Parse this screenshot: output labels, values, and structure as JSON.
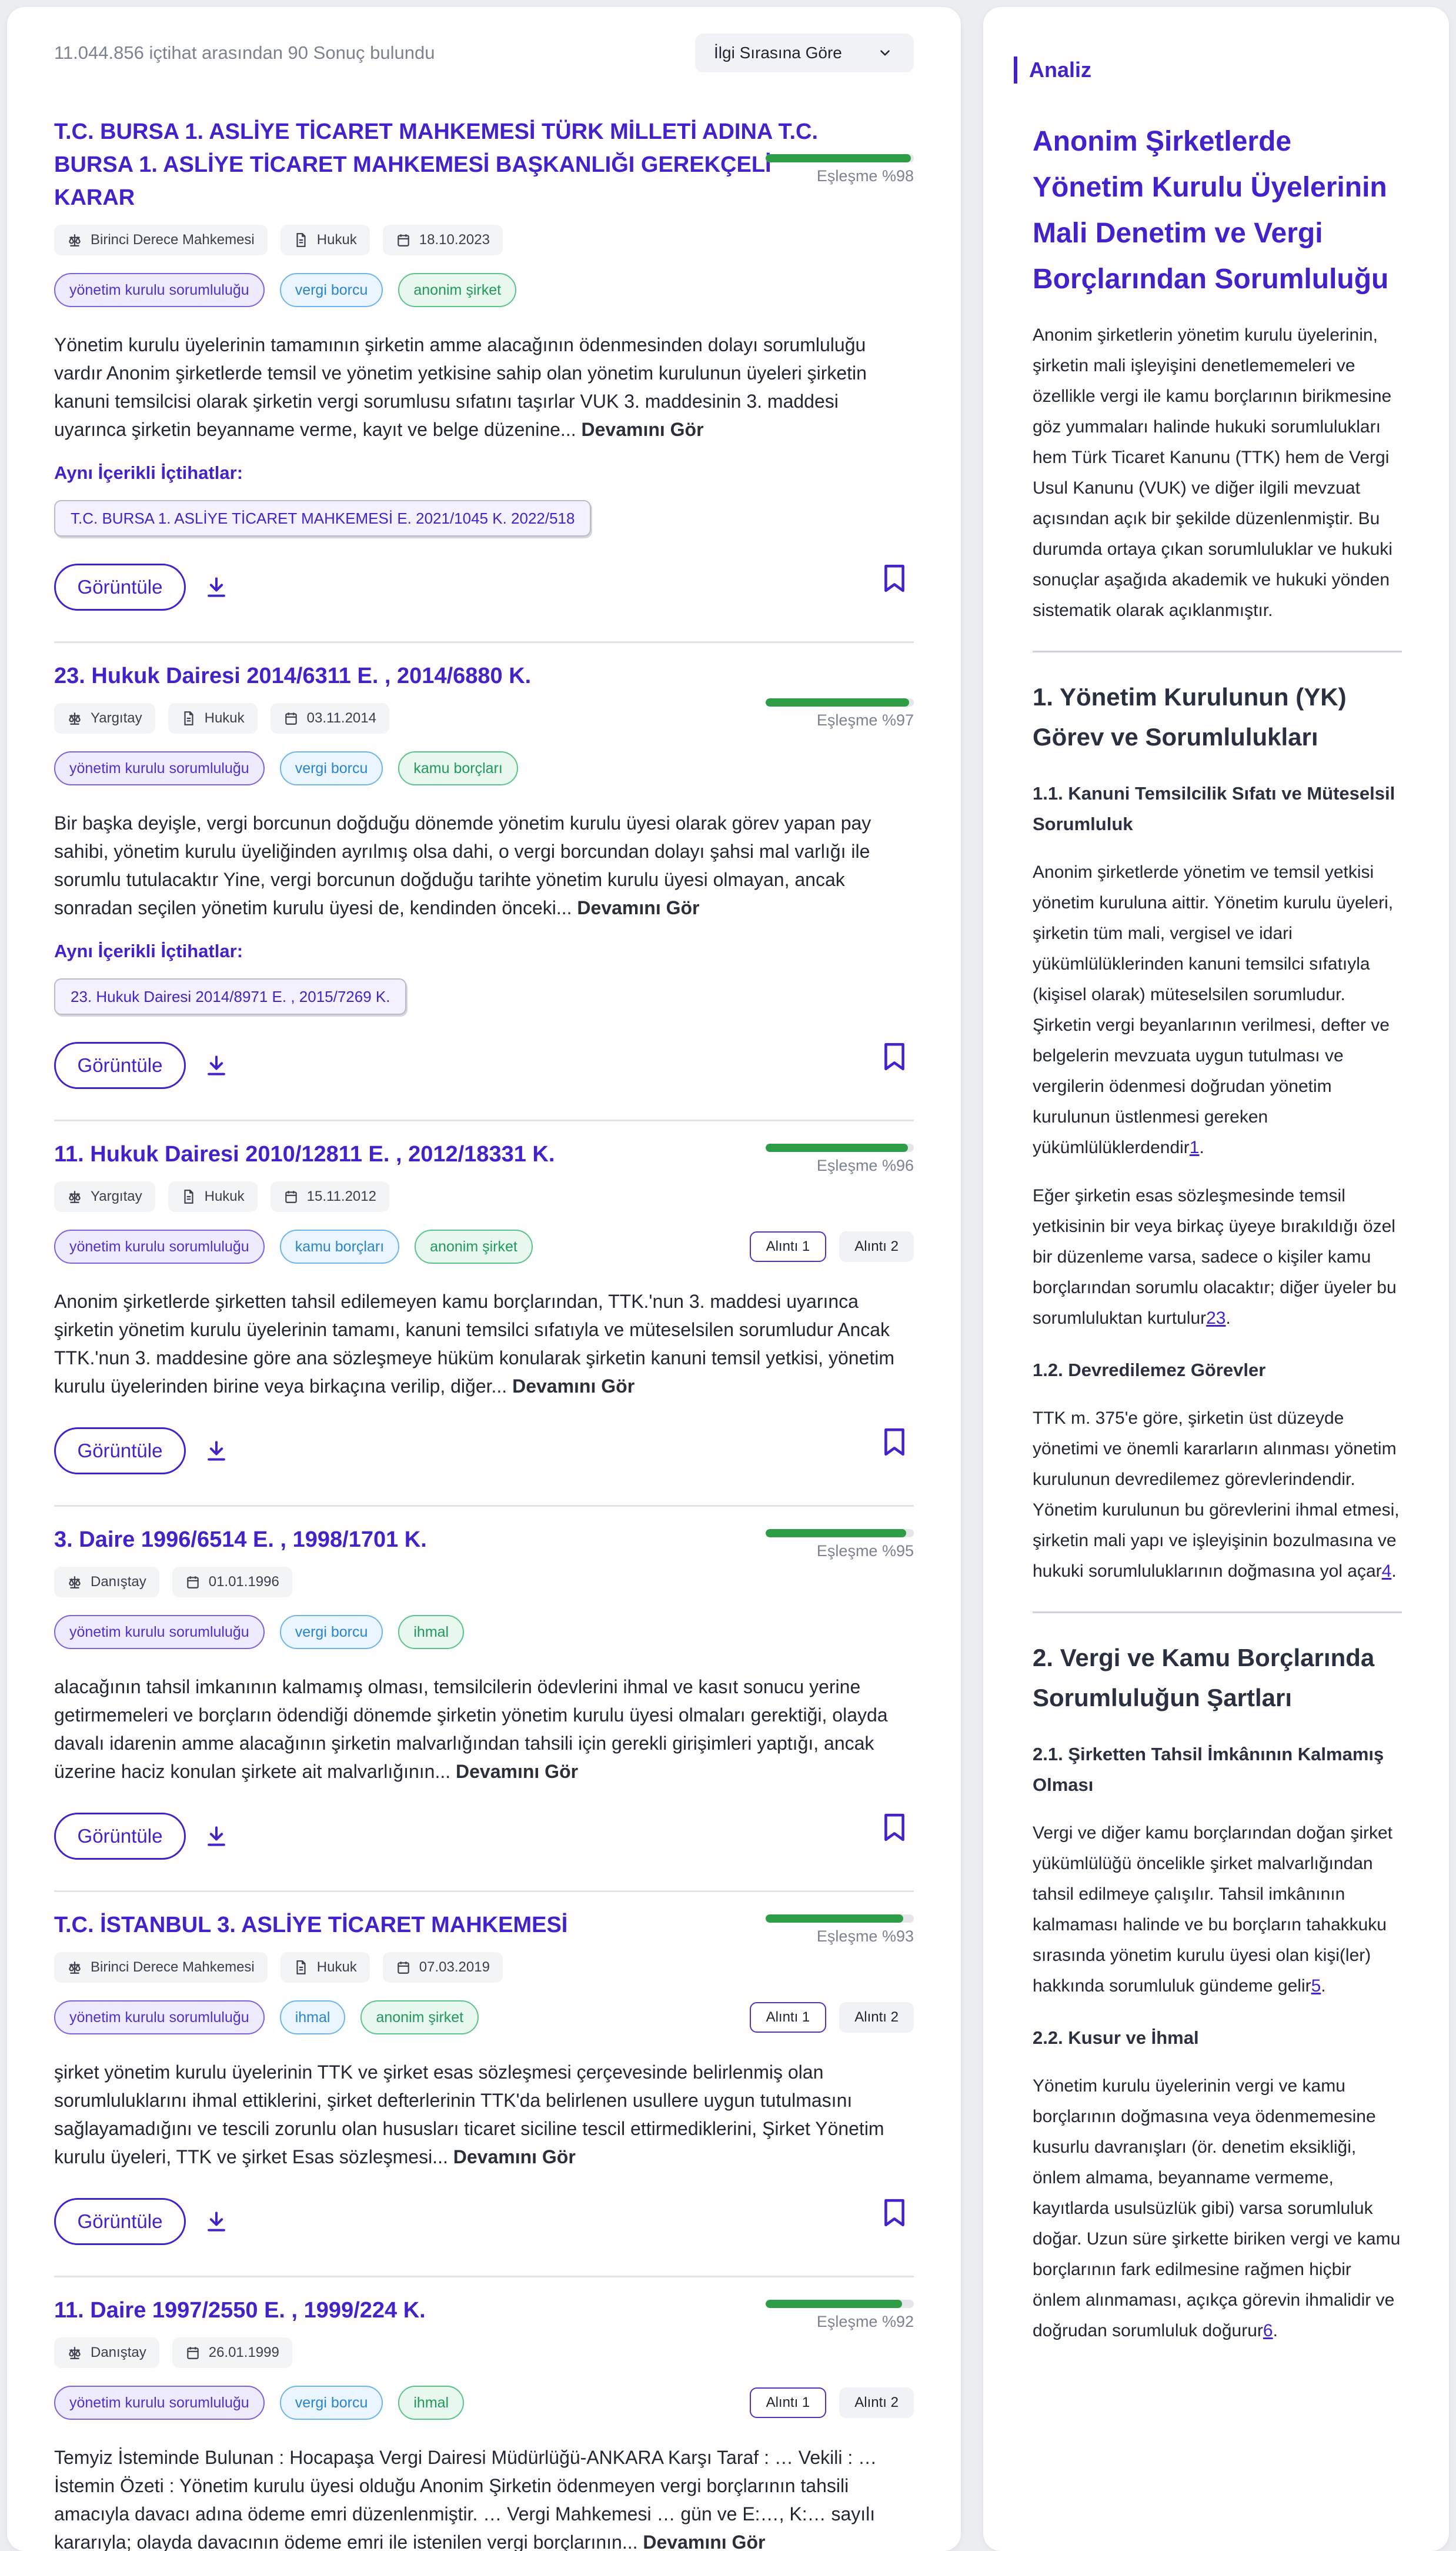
{
  "header": {
    "results_count": "11.044.856 içtihat arasından 90 Sonuç bulundu",
    "sort_label": "İlgi Sırasına Göre"
  },
  "labels": {
    "same_content": "Aynı İçerikli İçtihatlar:",
    "view": "Görüntüle",
    "more": "Devamını Gör",
    "quote1": "Alıntı 1",
    "quote2": "Alıntı 2"
  },
  "results": [
    {
      "title": "T.C. BURSA 1. ASLİYE TİCARET MAHKEMESİ TÜRK MİLLETİ ADINA T.C. BURSA 1. ASLİYE TİCARET MAHKEMESİ BAŞKANLIĞI GEREKÇELİ KARAR",
      "court": "Birinci Derece Mahkemesi",
      "type": "Hukuk",
      "date": "18.10.2023",
      "match_label": "Eşleşme %98",
      "match_fraction": 0.98,
      "tags": [
        "yönetim kurulu sorumluluğu",
        "vergi borcu",
        "anonim şirket"
      ],
      "snippet": "Yönetim kurulu üyelerinin tamamının şirketin amme alacağının ödenmesinden dolayı sorumluluğu vardır Anonim şirketlerde temsil ve yönetim yetkisine sahip olan yönetim kurulunun üyeleri şirketin kanuni temsilcisi olarak şirketin vergi sorumlusu sıfatını taşırlar VUK 3. maddesinin 3. maddesi uyarınca şirketin beyanname verme, kayıt ve belge düzenine...",
      "same": "T.C. BURSA 1. ASLİYE TİCARET MAHKEMESİ E. 2021/1045 K. 2022/518"
    },
    {
      "title": "23. Hukuk Dairesi 2014/6311 E. , 2014/6880 K.",
      "court": "Yargıtay",
      "type": "Hukuk",
      "date": "03.11.2014",
      "match_label": "Eşleşme %97",
      "match_fraction": 0.97,
      "tags": [
        "yönetim kurulu sorumluluğu",
        "vergi borcu",
        "kamu borçları"
      ],
      "snippet": "Bir başka deyişle, vergi borcunun doğduğu dönemde yönetim kurulu üyesi olarak görev yapan pay sahibi, yönetim kurulu üyeliğinden ayrılmış olsa dahi, o vergi borcundan dolayı şahsi mal varlığı ile sorumlu tutulacaktır Yine, vergi borcunun doğduğu tarihte yönetim kurulu üyesi olmayan, ancak sonradan seçilen yönetim kurulu üyesi de, kendinden önceki...",
      "same": "23. Hukuk Dairesi 2014/8971 E. , 2015/7269 K."
    },
    {
      "title": "11. Hukuk Dairesi 2010/12811 E. , 2012/18331 K.",
      "court": "Yargıtay",
      "type": "Hukuk",
      "date": "15.11.2012",
      "match_label": "Eşleşme %96",
      "match_fraction": 0.96,
      "tags": [
        "yönetim kurulu sorumluluğu",
        "kamu borçları",
        "anonim şirket"
      ],
      "snippet": "Anonim şirketlerde şirketten tahsil edilemeyen kamu borçlarından, TTK.'nun 3. maddesi uyarınca şirketin yönetim kurulu üyelerinin tamamı, kanuni temsilci sıfatıyla ve müteselsilen sorumludur Ancak TTK.'nun 3. maddesine göre ana sözleşmeye hüküm konularak şirketin kanuni temsil yetkisi, yönetim kurulu üyelerinden birine veya birkaçına verilip, diğer..."
    },
    {
      "title": "3. Daire 1996/6514 E. , 1998/1701 K.",
      "court": "Danıştay",
      "date": "01.01.1996",
      "match_label": "Eşleşme %95",
      "match_fraction": 0.95,
      "tags": [
        "yönetim kurulu sorumluluğu",
        "vergi borcu",
        "ihmal"
      ],
      "snippet": "alacağının tahsil imkanının kalmamış olması, temsilcilerin ödevlerini ihmal ve kasıt sonucu yerine getirmemeleri ve borçların ödendiği dönemde şirketin yönetim kurulu üyesi olmaları gerektiği, olayda davalı idarenin amme alacağının şirketin malvarlığından tahsili için gerekli girişimleri yaptığı, ancak üzerine haciz konulan şirkete ait malvarlığının..."
    },
    {
      "title": "T.C. İSTANBUL 3. ASLİYE TİCARET MAHKEMESİ",
      "court": "Birinci Derece Mahkemesi",
      "type": "Hukuk",
      "date": "07.03.2019",
      "match_label": "Eşleşme %93",
      "match_fraction": 0.93,
      "tags": [
        "yönetim kurulu sorumluluğu",
        "ihmal",
        "anonim şirket"
      ],
      "snippet": "şirket yönetim kurulu üyelerinin TTK ve şirket esas sözleşmesi çerçevesinde belirlenmiş olan sorumluluklarını ihmal ettiklerini, şirket defterlerinin TTK'da belirlenen usullere uygun tutulmasını sağlayamadığını ve tescili zorunlu olan hususları ticaret siciline tescil ettirmediklerini, Şirket Yönetim kurulu üyeleri, TTK ve şirket Esas sözleşmesi..."
    },
    {
      "title": "11. Daire 1997/2550 E. , 1999/224 K.",
      "court": "Danıştay",
      "date": "26.01.1999",
      "match_label": "Eşleşme %92",
      "match_fraction": 0.92,
      "tags": [
        "yönetim kurulu sorumluluğu",
        "vergi borcu",
        "ihmal"
      ],
      "snippet": "Temyiz İsteminde Bulunan : Hocapaşa Vergi Dairesi Müdürlüğü-ANKARA Karşı Taraf : … Vekili : … İstemin Özeti : Yönetim kurulu üyesi olduğu Anonim Şirketin ödenmeyen vergi borçlarının tahsili amacıyla davacı adına ödeme emri düzenlenmiştir. … Vergi Mahkemesi … gün ve E:…, K:… sayılı kararıyla; olayda davacının ödeme emri ile istenilen vergi borçlarının..."
    }
  ],
  "analysis": {
    "tab": "Analiz",
    "title": "Anonim Şirketlerde Yönetim Kurulu Üyelerinin Mali Denetim ve Vergi Borçlarından Sorumluluğu",
    "intro": "Anonim şirketlerin yönetim kurulu üyelerinin, şirketin mali işleyişini denetlememeleri ve özellikle vergi ile kamu borçlarının birikmesine göz yummaları halinde hukuki sorumlulukları hem Türk Ticaret Kanunu (TTK) hem de Vergi Usul Kanunu (VUK) ve diğer ilgili mevzuat açısından açık bir şekilde düzenlenmiştir. Bu durumda ortaya çıkan sorumluluklar ve hukuki sonuçlar aşağıda akademik ve hukuki yönden sistematik olarak açıklanmıştır.",
    "s1_title": "1. Yönetim Kurulunun (YK) Görev ve Sorumlulukları",
    "s11_title": "1.1. Kanuni Temsilcilik Sıfatı ve Müteselsil Sorumluluk",
    "s11_p1": "Anonim şirketlerde yönetim ve temsil yetkisi yönetim kuruluna aittir. Yönetim kurulu üyeleri, şirketin tüm mali, vergisel ve idari yükümlülüklerinden kanuni temsilci sıfatıyla (kişisel olarak) müteselsilen sorumludur. Şirketin vergi beyanlarının verilmesi, defter ve belgelerin mevzuata uygun tutulması ve vergilerin ödenmesi doğrudan yönetim kurulunun üstlenmesi gereken yükümlülüklerdendir",
    "s11_ref1": "1",
    "s11_p2": "Eğer şirketin esas sözleşmesinde temsil yetkisinin bir veya birkaç üyeye bırakıldığı özel bir düzenleme varsa, sadece o kişiler kamu borçlarından sorumlu olacaktır; diğer üyeler bu sorumluluktan kurtulur",
    "s11_ref2": "23",
    "s12_title": "1.2. Devredilemez Görevler",
    "s12_p": "TTK m. 375'e göre, şirketin üst düzeyde yönetimi ve önemli kararların alınması yönetim kurulunun devredilemez görevlerindendir. Yönetim kurulunun bu görevlerini ihmal etmesi, şirketin mali yapı ve işleyişinin bozulmasına ve hukuki sorumluluklarının doğmasına yol açar",
    "s12_ref": "4",
    "s2_title": "2. Vergi ve Kamu Borçlarında Sorumluluğun Şartları",
    "s21_title": "2.1. Şirketten Tahsil İmkânının Kalmamış Olması",
    "s21_p": "Vergi ve diğer kamu borçlarından doğan şirket yükümlülüğü öncelikle şirket malvarlığından tahsil edilmeye çalışılır. Tahsil imkânının kalmaması halinde ve bu borçların tahakkuku sırasında yönetim kurulu üyesi olan kişi(ler) hakkında sorumluluk gündeme gelir",
    "s21_ref": "5",
    "s22_title": "2.2. Kusur ve İhmal",
    "s22_p": "Yönetim kurulu üyelerinin vergi ve kamu borçlarının doğmasına veya ödenmemesine kusurlu davranışları (ör. denetim eksikliği, önlem almama, beyanname vermeme, kayıtlarda usulsüzlük gibi) varsa sorumluluk doğar. Uzun süre şirkette biriken vergi ve kamu borçlarının fark edilmesine rağmen hiçbir önlem alınmaması, açıkça görevin ihmalidir ve doğrudan sorumluluk doğurur",
    "s22_ref": "6"
  },
  "colors": {
    "accent": "#4323c9",
    "match_bar": "#2e9e46",
    "tag_purple": "#7c62dd",
    "tag_blue": "#6fb5ea",
    "tag_green": "#5cc38a"
  }
}
